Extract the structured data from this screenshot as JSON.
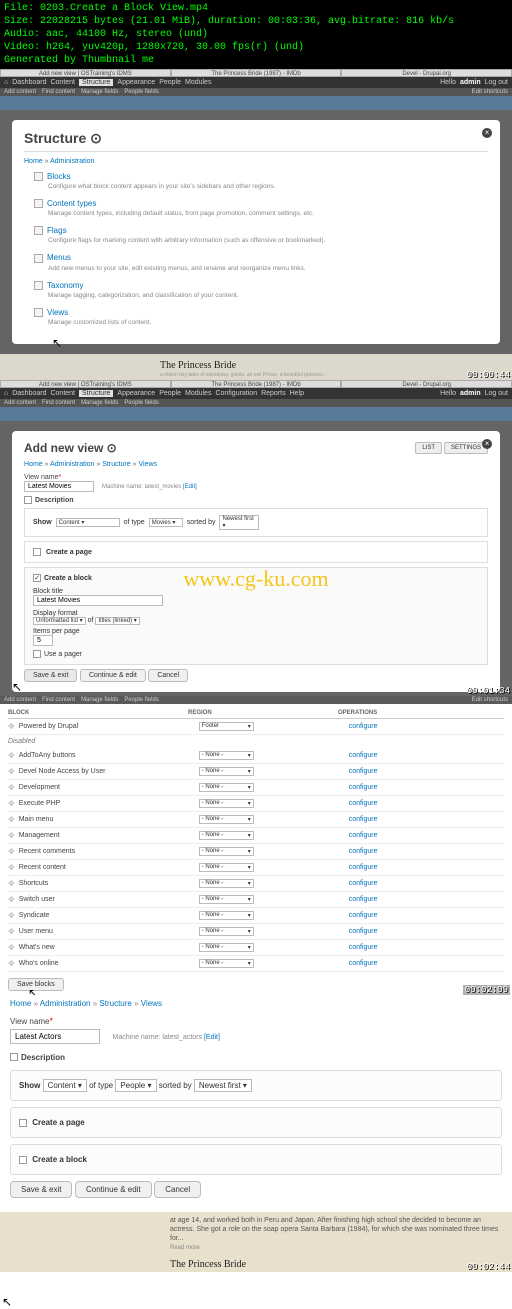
{
  "meta": {
    "filename": "File: 0203.Create a Block View.mp4",
    "size": "Size: 22028215 bytes (21.01 MiB), duration: 00:03:36, avg.bitrate: 816 kb/s",
    "audio": "Audio: aac, 44100 Hz, stereo (und)",
    "video": "Video: h264, yuv420p, 1280x720, 30.00 fps(r) (und)",
    "gen": "Generated by Thumbnail me"
  },
  "tabs": {
    "left": "Add new view | OSTraining's IDMS",
    "mid": "The Princess Bride (1987) - IMDb",
    "right": "Devel - Drupal.org"
  },
  "admin": {
    "home": "⌂",
    "dash": "Dashboard",
    "content": "Content",
    "structure": "Structure",
    "appearance": "Appearance",
    "people": "People",
    "modules": "Modules",
    "config": "Configuration",
    "reports": "Reports",
    "help": "Help",
    "hello": "Hello",
    "user": "admin",
    "logout": "Log out"
  },
  "sub": {
    "add": "Add content",
    "find": "Find content",
    "mf": "Manage fields",
    "pf": "People fields",
    "edit": "Edit shortcuts"
  },
  "structure": {
    "title": "Structure ⊙",
    "bc_home": "Home",
    "bc_admin": "Administration",
    "items": [
      {
        "label": "Blocks",
        "desc": "Configure what block content appears in your site's sidebars and other regions."
      },
      {
        "label": "Content types",
        "desc": "Manage content types, including default status, front page promotion, comment settings, etc."
      },
      {
        "label": "Flags",
        "desc": "Configure flags for marking content with arbitrary information (such as offensive or bookmarked)."
      },
      {
        "label": "Menus",
        "desc": "Add new menus to your site, edit existing menus, and rename and reorganize menu links."
      },
      {
        "label": "Taxonomy",
        "desc": "Manage tagging, categorization, and classification of your content."
      },
      {
        "label": "Views",
        "desc": "Manage customized lists of content."
      }
    ]
  },
  "ts1": "00:00:44",
  "gap1": {
    "headline": "The Princess Bride",
    "sub": "a dozen tiny tales of swordplay, giants, an evil Prince, a beautiful princess..."
  },
  "addview": {
    "title": "Add new view ⊙",
    "tab_list": "LIST",
    "tab_settings": "SETTINGS",
    "bc_home": "Home",
    "bc_admin": "Administration",
    "bc_struct": "Structure",
    "bc_views": "Views",
    "vn_label": "View name",
    "vn_value": "Latest Movies",
    "machine_label": "Machine name:",
    "machine_name": "latest_movies",
    "edit": "[Edit]",
    "desc_label": "Description",
    "show_label": "Show",
    "show_val": "Content",
    "of_type": "of type",
    "type_val": "Movies",
    "sorted_by": "sorted by",
    "sort_val": "Newest first",
    "create_page": "Create a page",
    "create_block": "Create a block",
    "block_title_label": "Block title",
    "block_title_val": "Latest Movies",
    "disp_format": "Display format",
    "disp_val1": "Unformatted list",
    "disp_of": "of",
    "disp_val2": "titles (linked)",
    "items_pp": "Items per page",
    "items_val": "5",
    "use_pager": "Use a pager",
    "save_exit": "Save & exit",
    "cont_edit": "Continue & edit",
    "cancel": "Cancel"
  },
  "watermark": "www.cg-ku.com",
  "ts2": "00:01:34",
  "blocks": {
    "hdr_block": "BLOCK",
    "hdr_region": "REGION",
    "hdr_ops": "OPERATIONS",
    "powered": "Powered by Drupal",
    "powered_region": "Footer",
    "disabled": "Disabled",
    "rows": [
      {
        "n": "AddToAny buttons"
      },
      {
        "n": "Devel Node Access by User"
      },
      {
        "n": "Development"
      },
      {
        "n": "Execute PHP"
      },
      {
        "n": "Main menu"
      },
      {
        "n": "Management"
      },
      {
        "n": "Recent comments"
      },
      {
        "n": "Recent content"
      },
      {
        "n": "Shortcuts"
      },
      {
        "n": "Switch user"
      },
      {
        "n": "Syndicate"
      },
      {
        "n": "User menu"
      },
      {
        "n": "What's new"
      },
      {
        "n": "Who's online"
      }
    ],
    "none": "- None -",
    "configure": "configure",
    "save": "Save blocks"
  },
  "ts3": "00:02:09",
  "f4": {
    "bc_home": "Home",
    "bc_admin": "Administration",
    "bc_struct": "Structure",
    "bc_views": "Views",
    "vn_label": "View name",
    "vn_value": "Latest Actors",
    "mn_label": "Machine name:",
    "mn_value": "latest_actors",
    "edit": "[Edit]",
    "desc": "Description",
    "show": "Show",
    "show_v": "Content",
    "of_type": "of type",
    "type_v": "People",
    "sorted": "sorted by",
    "sort_v": "Newest first",
    "cp": "Create a page",
    "cb": "Create a block",
    "save": "Save & exit",
    "cont": "Continue & edit",
    "cancel": "Cancel",
    "para": "at age 14, and worked both in Peru and Japan. After finishing high school she decided to become an actress. She got a role on the soap opera Santa Barbara (1984), for which she was nominated three times for...",
    "read": "Read more",
    "pb": "The Princess Bride"
  },
  "ts4": "00:02:44"
}
